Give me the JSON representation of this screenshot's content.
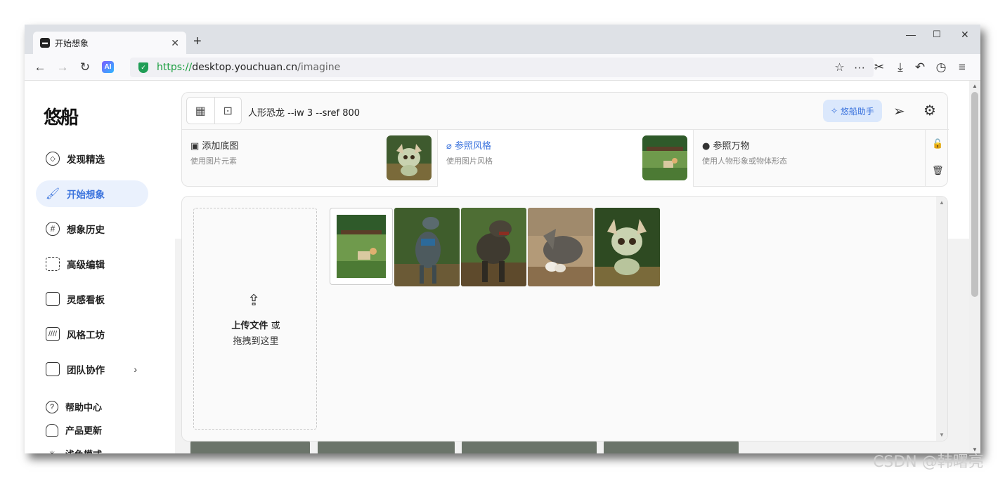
{
  "browser": {
    "tab_title": "开始想象",
    "url_proto": "https://",
    "url_host": "desktop.youchuan.cn",
    "url_path": "/imagine",
    "ai_label": "AI"
  },
  "sidebar": {
    "logo": "悠船",
    "items": [
      {
        "label": "发现精选",
        "icon": "compass-icon"
      },
      {
        "label": "开始想象",
        "icon": "brush-icon",
        "active": true
      },
      {
        "label": "想象历史",
        "icon": "grid-icon"
      },
      {
        "label": "高级编辑",
        "icon": "edit-frame-icon"
      },
      {
        "label": "灵感看板",
        "icon": "copy-icon"
      },
      {
        "label": "风格工坊",
        "icon": "stripes-icon"
      },
      {
        "label": "团队协作",
        "icon": "team-icon"
      }
    ],
    "bottom": [
      {
        "label": "帮助中心",
        "icon": "help-icon"
      },
      {
        "label": "产品更新",
        "icon": "bell-icon"
      },
      {
        "label": "浅色模式",
        "icon": "sun-icon"
      }
    ]
  },
  "prompt": {
    "text": "人形恐龙 --iw 3 --sref 800",
    "assistant_label": "悠船助手"
  },
  "references": [
    {
      "title": "添加底图",
      "subtitle": "使用图片元素"
    },
    {
      "title": "参照风格",
      "subtitle": "使用图片风格"
    },
    {
      "title": "参照万物",
      "subtitle": "使用人物形象或物体形态"
    }
  ],
  "upload": {
    "main_bold": "上传文件",
    "main_rest": " 或",
    "sub": "拖拽到这里"
  },
  "watermark": "CSDN @韩曙亮",
  "colors": {
    "accent": "#3b73dd",
    "active_bg": "#eaf1fd",
    "assistant_bg": "#dbe8fc"
  }
}
